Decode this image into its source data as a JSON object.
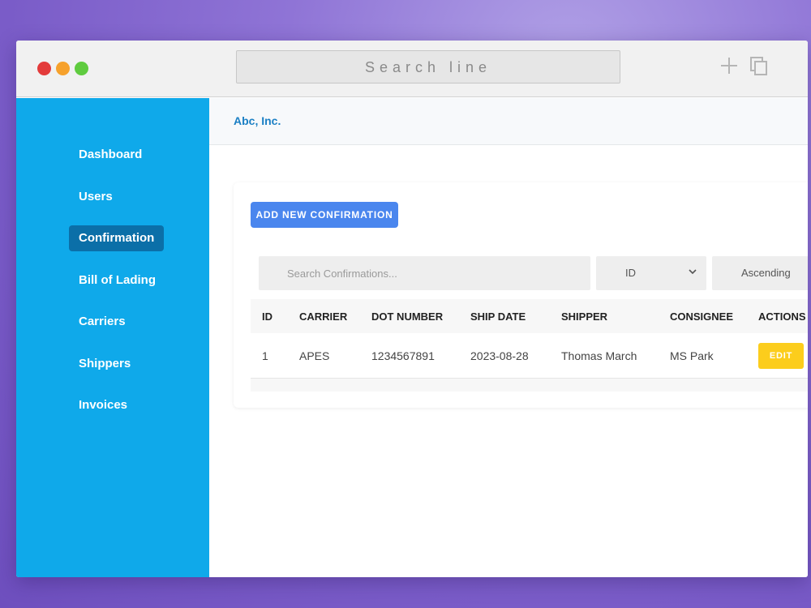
{
  "browser": {
    "address_text": "Search line",
    "icons": [
      "plus-icon",
      "copy-icon"
    ]
  },
  "sidebar": {
    "items": [
      {
        "label": "Dashboard"
      },
      {
        "label": "Users"
      },
      {
        "label": "Confirmation",
        "active": true
      },
      {
        "label": "Bill of Lading"
      },
      {
        "label": "Carriers"
      },
      {
        "label": "Shippers"
      },
      {
        "label": "Invoices"
      }
    ]
  },
  "header": {
    "company": "Abc, Inc."
  },
  "main": {
    "add_button_label": "ADD NEW CONFIRMATION",
    "search_placeholder": "Search Confirmations...",
    "sort_field": "ID",
    "sort_order": "Ascending",
    "table": {
      "headers": [
        "ID",
        "CARRIER",
        "DOT NUMBER",
        "SHIP DATE",
        "SHIPPER",
        "CONSIGNEE",
        "ACTIONS"
      ],
      "rows": [
        {
          "id": "1",
          "carrier": "APES",
          "dot_number": "1234567891",
          "ship_date": "2023-08-28",
          "shipper": "Thomas March",
          "consignee": "MS Park",
          "action_label": "EDIT"
        }
      ]
    }
  },
  "colors": {
    "sidebar": "#0fa9ea",
    "sidebar_active": "#0b6fa8",
    "primary_button": "#4a86ee",
    "edit_button": "#fccd1c",
    "company_text": "#1a7fc4"
  }
}
